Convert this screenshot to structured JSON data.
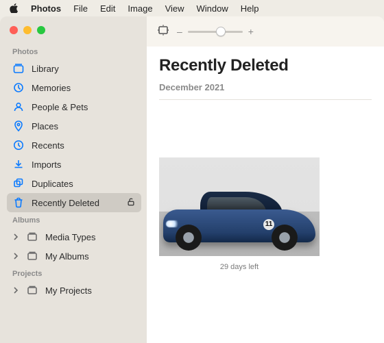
{
  "menubar": {
    "app": "Photos",
    "items": [
      "File",
      "Edit",
      "Image",
      "View",
      "Window",
      "Help"
    ]
  },
  "sidebar": {
    "section_photos": "Photos",
    "items_photos": [
      {
        "label": "Library"
      },
      {
        "label": "Memories"
      },
      {
        "label": "People & Pets"
      },
      {
        "label": "Places"
      },
      {
        "label": "Recents"
      },
      {
        "label": "Imports"
      },
      {
        "label": "Duplicates"
      },
      {
        "label": "Recently Deleted",
        "selected": true,
        "locked": false
      }
    ],
    "section_albums": "Albums",
    "items_albums": [
      {
        "label": "Media Types"
      },
      {
        "label": "My Albums"
      }
    ],
    "section_projects": "Projects",
    "items_projects": [
      {
        "label": "My Projects"
      }
    ]
  },
  "toolbar": {
    "zoom_minus": "–",
    "zoom_plus": "+",
    "zoom_value_pct": 60
  },
  "main": {
    "title": "Recently Deleted",
    "date_header": "December 2021",
    "thumb": {
      "caption": "29 days left",
      "badge": "11"
    }
  }
}
